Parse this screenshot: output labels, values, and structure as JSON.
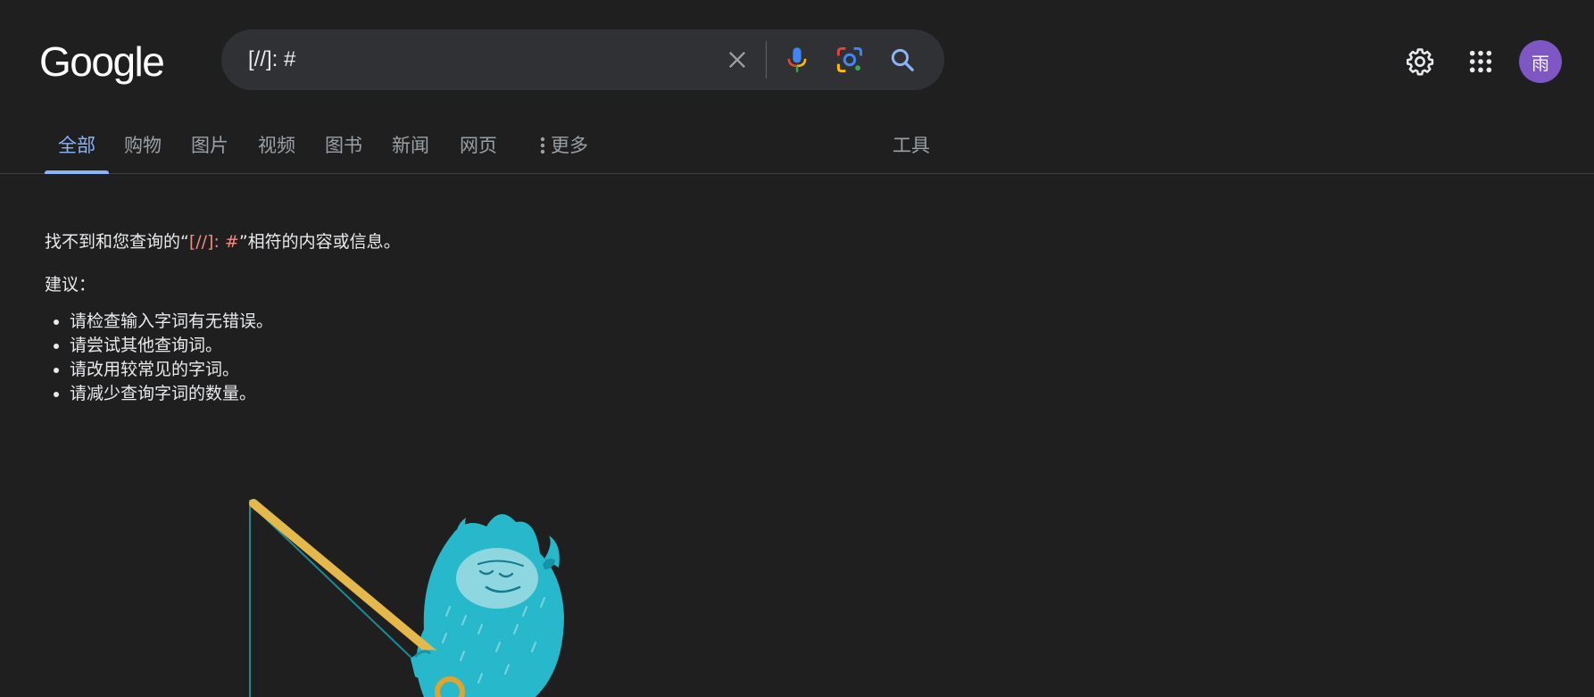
{
  "header": {
    "logo": "Google",
    "search": {
      "value": "[//]: #"
    },
    "avatar_initial": "雨"
  },
  "tabs": [
    {
      "label": "全部",
      "active": true
    },
    {
      "label": "购物"
    },
    {
      "label": "图片"
    },
    {
      "label": "视频"
    },
    {
      "label": "图书"
    },
    {
      "label": "新闻"
    },
    {
      "label": "网页"
    },
    {
      "label": "更多"
    },
    {
      "label": "工具"
    }
  ],
  "results": {
    "no_result_prefix": "找不到和您查询的“",
    "query": "[//]: #",
    "no_result_suffix": "”相符的内容或信息。",
    "suggestions_title": "建议：",
    "suggestions": [
      "请检查输入字词有无错误。",
      "请尝试其他查询词。",
      "请改用较常见的字词。",
      "请减少查询字词的数量。"
    ]
  },
  "colors": {
    "background": "#1f1f1f",
    "accent": "#8ab4f8",
    "query_highlight": "#f28b82",
    "avatar_bg": "#7e57c2"
  },
  "icons": [
    "clear-icon",
    "mic-icon",
    "lens-icon",
    "search-icon",
    "settings-icon",
    "apps-icon",
    "more-dots-icon"
  ]
}
